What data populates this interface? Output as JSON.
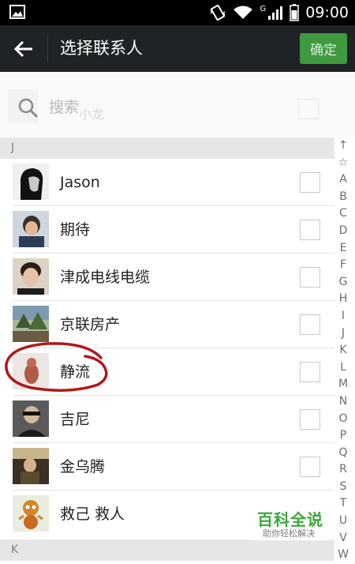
{
  "status_bar": {
    "time": "09:00",
    "signal_type": "G",
    "icons": [
      "image-icon",
      "vibrate-icon",
      "wifi-icon",
      "signal-icon",
      "battery-icon"
    ]
  },
  "action_bar": {
    "title": "选择联系人",
    "confirm_label": "确定",
    "back_icon": "arrow-left-icon"
  },
  "search": {
    "placeholder": "搜索",
    "ghost_text": "小龙"
  },
  "sections": [
    {
      "letter": "J",
      "contacts": [
        {
          "name": "Jason",
          "checked": false,
          "avatar_color": "#1a1a1a"
        },
        {
          "name": "期待",
          "checked": false,
          "avatar_color": "#6b7a8c"
        },
        {
          "name": "津成电线电缆",
          "checked": false,
          "avatar_color": "#5b4a3a"
        },
        {
          "name": "京联房产",
          "checked": false,
          "avatar_color": "#4a6a3a"
        },
        {
          "name": "静流",
          "checked": false,
          "avatar_color": "#b25a4a"
        },
        {
          "name": "吉尼",
          "checked": false,
          "avatar_color": "#2a2a2a"
        },
        {
          "name": "金乌腾",
          "checked": false,
          "avatar_color": "#5a4a30"
        },
        {
          "name": "救己 救人",
          "checked": false,
          "avatar_color": "#d2862c"
        }
      ]
    },
    {
      "letter": "K",
      "contacts": []
    }
  ],
  "index_letters": [
    "↑",
    "☆",
    "A",
    "B",
    "C",
    "D",
    "E",
    "F",
    "G",
    "H",
    "I",
    "J",
    "K",
    "L",
    "M",
    "N",
    "O",
    "P",
    "Q",
    "R",
    "S",
    "T",
    "U",
    "V",
    "W"
  ],
  "watermark": {
    "title": "百科全说",
    "subtitle": "助你轻松解决"
  },
  "colors": {
    "action_bar": "#1f2226",
    "confirm_button": "#3f9a3f",
    "annotation_stroke": "#b01818",
    "watermark_green": "#3aa83a"
  }
}
